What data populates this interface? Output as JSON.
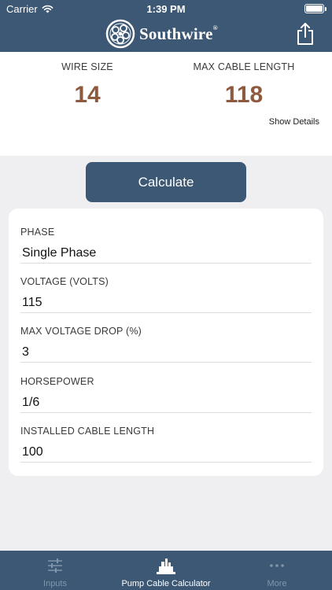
{
  "status_bar": {
    "carrier": "Carrier",
    "time": "1:39 PM"
  },
  "header": {
    "brand": "Southwire",
    "brand_mark": "®",
    "share_icon": "share-icon"
  },
  "results": {
    "wire_size_label": "WIRE SIZE",
    "wire_size_value": "14",
    "max_cable_length_label": "MAX CABLE LENGTH",
    "max_cable_length_value": "118",
    "show_details": "Show Details"
  },
  "calculate_label": "Calculate",
  "inputs": [
    {
      "label": "PHASE",
      "value": "Single Phase"
    },
    {
      "label": "VOLTAGE (VOLTS)",
      "value": "115"
    },
    {
      "label": "MAX VOLTAGE DROP (%)",
      "value": "3"
    },
    {
      "label": "HORSEPOWER",
      "value": "1/6"
    },
    {
      "label": "INSTALLED CABLE LENGTH",
      "value": "100"
    }
  ],
  "tabs": [
    {
      "label": "Inputs",
      "icon": "sliders-icon",
      "active": false
    },
    {
      "label": "Pump Cable Calculator",
      "icon": "pump-icon",
      "active": true
    },
    {
      "label": "More",
      "icon": "more-dots-icon",
      "active": false
    }
  ],
  "colors": {
    "brand_blue": "#3d5875",
    "result_value": "#8e5a3f",
    "background": "#efeff1"
  }
}
